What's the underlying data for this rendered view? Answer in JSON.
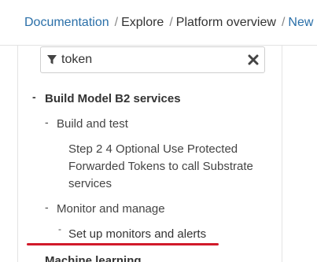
{
  "breadcrumb": {
    "items": [
      "Documentation",
      "Explore",
      "Platform overview",
      "New"
    ],
    "separator": "/"
  },
  "filter": {
    "value": "token",
    "icon": "filter-icon",
    "clear_icon": "close-icon"
  },
  "tree": {
    "section_build": "Build Model B2 services",
    "build_and_test": "Build and test",
    "step_item": "Step 2 4 Optional Use Protected Forwarded Tokens to call Substrate services",
    "monitor_and_manage": "Monitor and manage",
    "setup_monitors": "Set up monitors and alerts",
    "section_machine_learning": "Machine learning",
    "bullet": "-"
  },
  "colors": {
    "link": "#2a6fa8",
    "active_underline": "#d11a2a"
  }
}
